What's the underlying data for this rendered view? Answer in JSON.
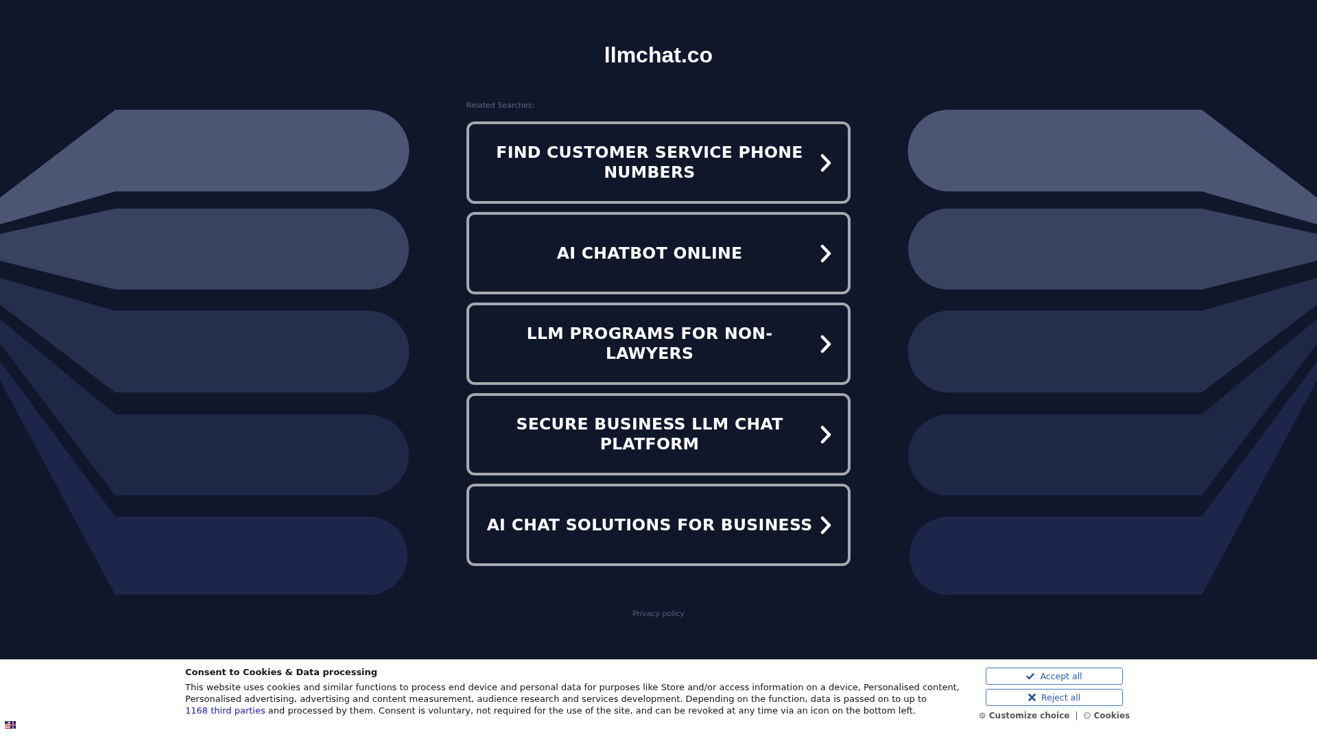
{
  "header": {
    "site_title": "llmchat.co"
  },
  "related_searches": {
    "label": "Related Searches:",
    "items": [
      "FIND CUSTOMER SERVICE PHONE NUMBERS",
      "AI CHATBOT ONLINE",
      "LLM PROGRAMS FOR NON-LAWYERS",
      "SECURE BUSINESS LLM CHAT PLATFORM",
      "AI CHAT SOLUTIONS FOR BUSINESS"
    ]
  },
  "footer": {
    "privacy_link": "Privacy policy"
  },
  "consent_banner": {
    "title": "Consent to Cookies & Data processing",
    "text_before_link": "This website uses cookies and similar functions to process end device and personal data for purposes like Store and/or access information on a device, Personalised content, Personalised advertising, advertising and content measurement, audience research and services development. Depending on the function, data is passed on to up to",
    "link": "1168 third parties",
    "text_after_link": "and processed by them. Consent is voluntary, not required for the use of the site, and can be revoked at any time via an icon on the bottom left.",
    "buttons": [
      {
        "kind": "accept",
        "label": "Accept all"
      },
      {
        "kind": "reject",
        "label": "Reject all"
      }
    ],
    "links": [
      {
        "kind": "customize",
        "label": "Customize choice"
      },
      {
        "kind": "cookies",
        "label": "Cookies"
      }
    ],
    "separator": "|"
  }
}
